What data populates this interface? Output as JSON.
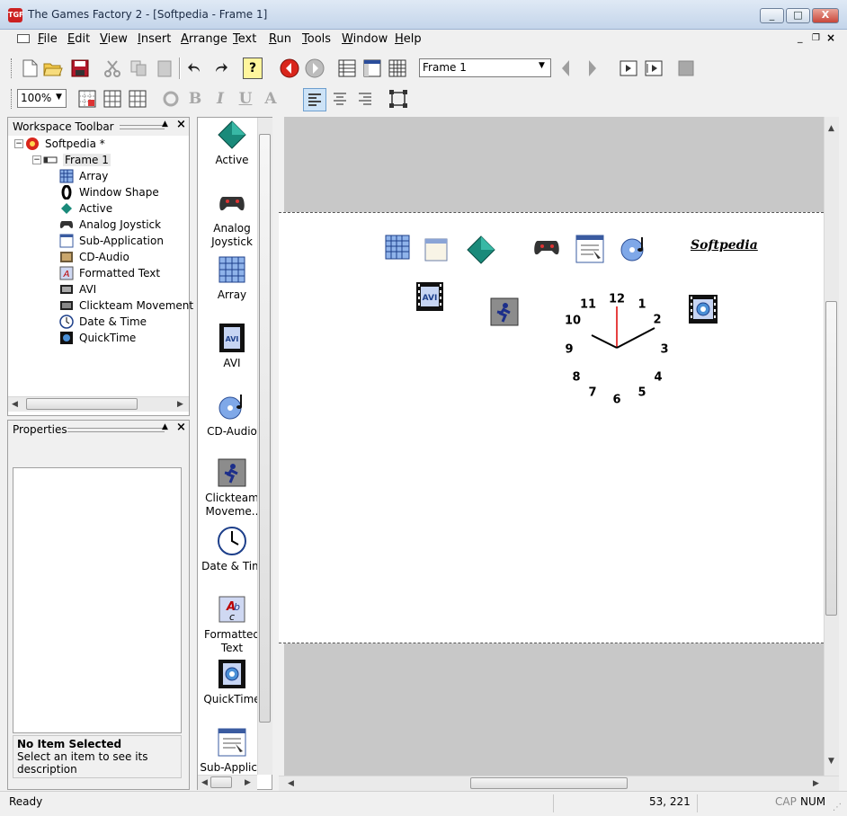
{
  "window": {
    "title": "The Games Factory 2 - [Softpedia - Frame 1]",
    "min": "_",
    "max": "□",
    "close": "X"
  },
  "menu": [
    "File",
    "Edit",
    "View",
    "Insert",
    "Arrange",
    "Text",
    "Run",
    "Tools",
    "Window",
    "Help"
  ],
  "toolbar": {
    "frame_select": "Frame 1",
    "zoom_select": "100%",
    "text_bold": "B",
    "text_italic": "I",
    "text_underline": "U",
    "text_font": "A",
    "help_icon": "?"
  },
  "workspace": {
    "title": "Workspace Toolbar",
    "root": "Softpedia *",
    "frame": "Frame 1",
    "objects": [
      "Array",
      "Window Shape",
      "Active",
      "Analog Joystick",
      "Sub-Application",
      "CD-Audio",
      "Formatted Text",
      "AVI",
      "Clickteam Movement",
      "Date & Time",
      "QuickTime"
    ]
  },
  "properties": {
    "title": "Properties",
    "no_item_title": "No Item Selected",
    "no_item_desc": "Select an item to see its description"
  },
  "library": [
    "Active",
    "Analog Joystick",
    "Array",
    "AVI",
    "CD-Audio",
    "Clickteam Moveme..",
    "Date & Tim",
    "Formatted Text",
    "QuickTime",
    "Sub-Applic.."
  ],
  "frame": {
    "softpedia_text": "Softpedia",
    "clock_numbers": [
      "12",
      "1",
      "2",
      "3",
      "4",
      "5",
      "6",
      "7",
      "8",
      "9",
      "10",
      "11"
    ],
    "avi_label": "AVI"
  },
  "status": {
    "text": "Ready",
    "coords": "53, 221",
    "cap": "CAP",
    "num": "NUM"
  },
  "colors": {
    "title_bar": "#c4d5ea",
    "playfield": "#ffffff",
    "editor_bg": "#c8c8c8",
    "accent_red": "#cc2020",
    "active_teal": "#1a8a7a"
  }
}
